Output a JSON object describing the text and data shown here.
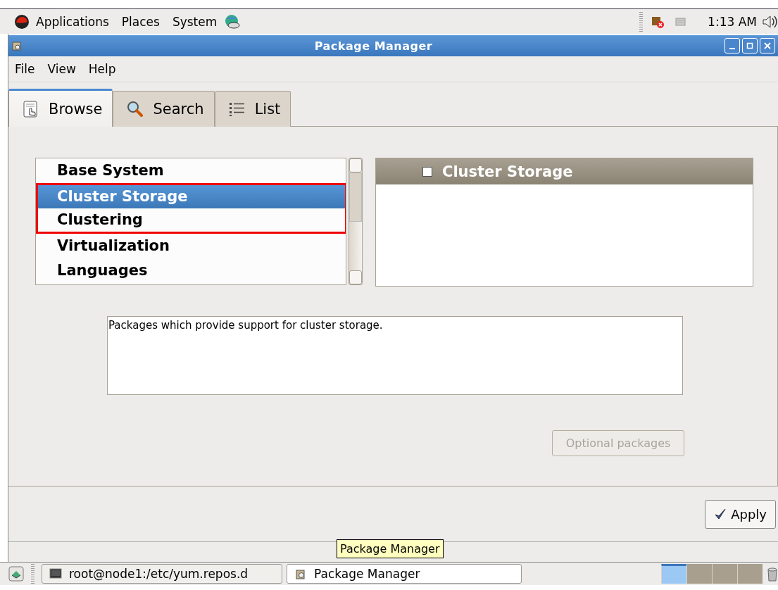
{
  "top_panel": {
    "menus": [
      "Applications",
      "Places",
      "System"
    ],
    "clock": "1:13 AM"
  },
  "window": {
    "title": "Package Manager"
  },
  "menu_bar": [
    "File",
    "View",
    "Help"
  ],
  "tabs": [
    {
      "label": "Browse",
      "kind": "browse",
      "selected": true
    },
    {
      "label": "Search",
      "kind": "search",
      "selected": false
    },
    {
      "label": "List",
      "kind": "list",
      "selected": false
    }
  ],
  "categories": [
    {
      "label": "Base System",
      "selected": false,
      "annotated": false
    },
    {
      "label": "Cluster Storage",
      "selected": true,
      "annotated": true
    },
    {
      "label": "Clustering",
      "selected": false,
      "annotated": true
    },
    {
      "label": "Virtualization",
      "selected": false,
      "annotated": false
    },
    {
      "label": "Languages",
      "selected": false,
      "annotated": false
    }
  ],
  "group_header": {
    "label": "Cluster Storage",
    "checked": false
  },
  "description": "Packages which provide support for cluster storage.",
  "optional_button": {
    "label": "Optional packages",
    "disabled": true
  },
  "apply_button": {
    "label": "Apply"
  },
  "tooltip": "Package Manager",
  "taskbar": {
    "tasks": [
      {
        "label": "root@node1:/etc/yum.repos.d",
        "kind": "terminal",
        "selected": false
      },
      {
        "label": "Package Manager",
        "kind": "package",
        "selected": true
      }
    ],
    "workspaces": [
      {
        "selected": true
      },
      {
        "selected": false
      },
      {
        "selected": false
      },
      {
        "selected": false
      }
    ]
  }
}
